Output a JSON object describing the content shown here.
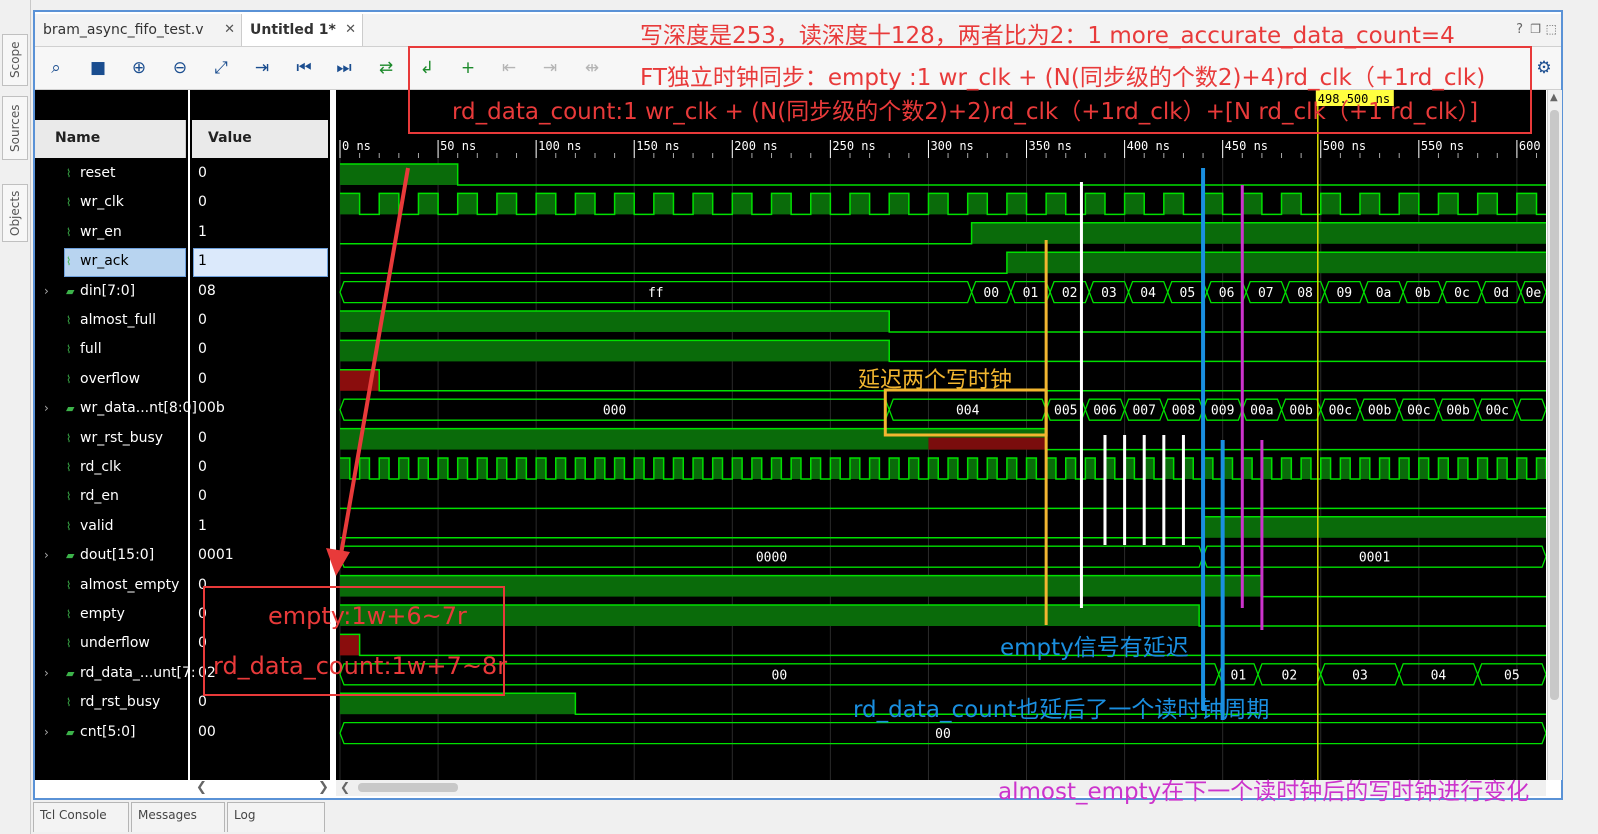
{
  "side_tabs": [
    "Scope",
    "Sources",
    "Objects"
  ],
  "doc_tabs": [
    {
      "label": "bram_async_fifo_test.v",
      "active": false
    },
    {
      "label": "Untitled 1*",
      "active": true
    }
  ],
  "columns": {
    "name": "Name",
    "value": "Value"
  },
  "signals": [
    {
      "name": "reset",
      "value": "0",
      "bus": false
    },
    {
      "name": "wr_clk",
      "value": "0",
      "bus": false
    },
    {
      "name": "wr_en",
      "value": "1",
      "bus": false
    },
    {
      "name": "wr_ack",
      "value": "1",
      "bus": false
    },
    {
      "name": "din[7:0]",
      "value": "08",
      "bus": true
    },
    {
      "name": "almost_full",
      "value": "0",
      "bus": false
    },
    {
      "name": "full",
      "value": "0",
      "bus": false
    },
    {
      "name": "overflow",
      "value": "0",
      "bus": false
    },
    {
      "name": "wr_data...nt[8:0]",
      "value": "00b",
      "bus": true
    },
    {
      "name": "wr_rst_busy",
      "value": "0",
      "bus": false
    },
    {
      "name": "rd_clk",
      "value": "0",
      "bus": false
    },
    {
      "name": "rd_en",
      "value": "0",
      "bus": false
    },
    {
      "name": "valid",
      "value": "1",
      "bus": false
    },
    {
      "name": "dout[15:0]",
      "value": "0001",
      "bus": true
    },
    {
      "name": "almost_empty",
      "value": "0",
      "bus": false
    },
    {
      "name": "empty",
      "value": "0",
      "bus": false
    },
    {
      "name": "underflow",
      "value": "0",
      "bus": false
    },
    {
      "name": "rd_data_...unt[7:",
      "value": "02",
      "bus": true
    },
    {
      "name": "rd_rst_busy",
      "value": "0",
      "bus": false
    },
    {
      "name": "cnt[5:0]",
      "value": "00",
      "bus": true
    }
  ],
  "timeline": {
    "ticks": [
      "0 ns",
      "50 ns",
      "100 ns",
      "150 ns",
      "200 ns",
      "250 ns",
      "300 ns",
      "350 ns",
      "400 ns",
      "450 ns",
      "500 ns",
      "550 ns",
      "600"
    ],
    "cursor_label": "498.500 ns"
  },
  "bus_values": {
    "din_first": "ff",
    "din": [
      "00",
      "01",
      "02",
      "03",
      "04",
      "05",
      "06",
      "07",
      "08",
      "09",
      "0a",
      "0b",
      "0c",
      "0d",
      "0e"
    ],
    "wr_count": [
      "000",
      "004",
      "005",
      "006",
      "007",
      "008",
      "009",
      "00a",
      "00b",
      "00c",
      "00b",
      "00c",
      "00b",
      "00c"
    ],
    "dout": [
      "0000",
      "0001"
    ],
    "rd_count": [
      "00",
      "01",
      "02",
      "03",
      "04",
      "05"
    ],
    "cnt": "00"
  },
  "annotations": {
    "header_line1": "写深度是253，读深度十128，两者比为2：1  more_accurate_data_count=4",
    "header_line2": "FT独立时钟同步：empty :1 wr_clk + (N(同步级的个数2)+4)rd_clk（+1rd_clk)",
    "header_line3": "rd_data_count:1 wr_clk + (N(同步级的个数2)+2)rd_clk（+1rd_clk）+[N rd_clk（+1 rd_clk）]",
    "delay_two": "延迟两个写时钟",
    "empty_formula": "empty:1w+6~7r",
    "rd_count_formula": "rd_data_count:1w+7~8r",
    "empty_delay": "empty信号有延迟",
    "rd_count_delay": "rd_data_count也延后了一个读时钟周期",
    "almost_empty_note": "almost_empty在下一个读时钟后的写时钟进行变化"
  },
  "bottom_tabs": [
    "Tcl Console",
    "Messages",
    "Log"
  ],
  "colors": {
    "wave_high": "#0a6b0a",
    "wave_line": "#00e000",
    "cursor": "#e0e000",
    "annotation_red": "#e83a3a"
  }
}
